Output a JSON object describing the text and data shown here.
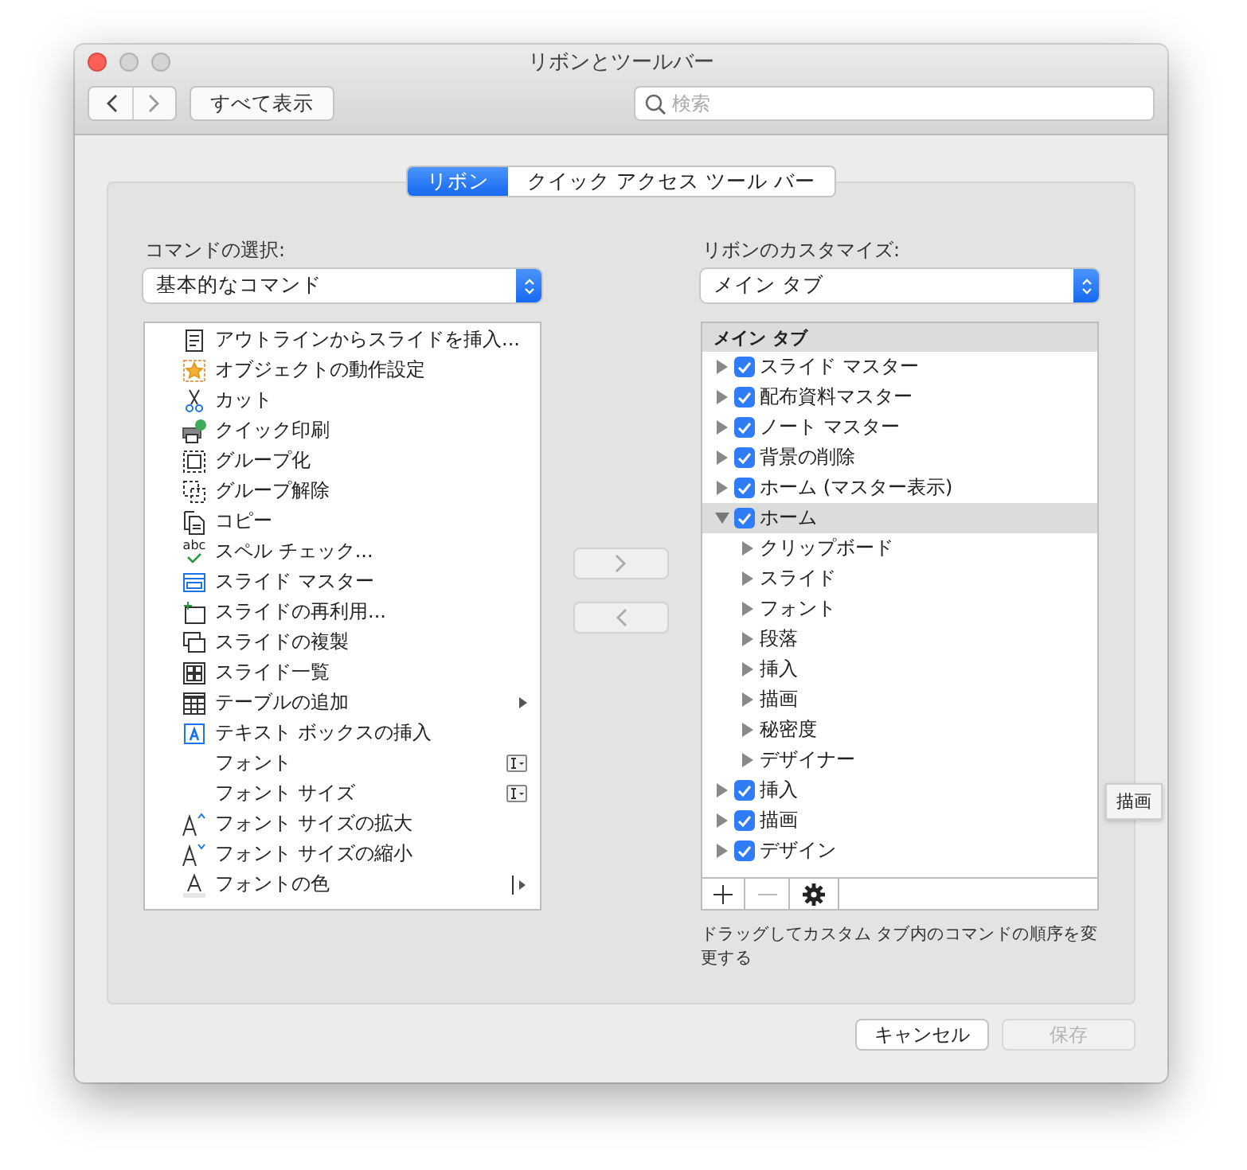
{
  "window": {
    "title": "リボンとツールバー"
  },
  "toolbar": {
    "show_all": "すべて表示",
    "search": {
      "placeholder": "検索"
    }
  },
  "tabs": [
    {
      "label": "リボン",
      "selected": true
    },
    {
      "label": "クイック アクセス ツール バー",
      "selected": false
    }
  ],
  "commands": {
    "label": "コマンドの選択:",
    "select": "基本的なコマンド",
    "items": [
      {
        "label": "アウトラインからスライドを挿入...",
        "kind": "outline"
      },
      {
        "label": "オブジェクトの動作設定",
        "kind": "action"
      },
      {
        "label": "カット",
        "kind": "cut"
      },
      {
        "label": "クイック印刷",
        "kind": "print"
      },
      {
        "label": "グループ化",
        "kind": "group"
      },
      {
        "label": "グループ解除",
        "kind": "ungroup"
      },
      {
        "label": "コピー",
        "kind": "copy"
      },
      {
        "label": "スペル チェック...",
        "kind": "spell",
        "icon_text": "abc"
      },
      {
        "label": "スライド マスター",
        "kind": "master"
      },
      {
        "label": "スライドの再利用...",
        "kind": "reuse"
      },
      {
        "label": "スライドの複製",
        "kind": "duplicate"
      },
      {
        "label": "スライド一覧",
        "kind": "sorter"
      },
      {
        "label": "テーブルの追加",
        "kind": "table",
        "trailing": {
          "kind": "submenu"
        }
      },
      {
        "label": "テキスト ボックスの挿入",
        "kind": "textbox"
      },
      {
        "label": "フォント",
        "kind": "none",
        "trailing": {
          "kind": "combo"
        }
      },
      {
        "label": "フォント サイズ",
        "kind": "none",
        "trailing": {
          "kind": "combo"
        }
      },
      {
        "label": "フォント サイズの拡大",
        "kind": "grow"
      },
      {
        "label": "フォント サイズの縮小",
        "kind": "shrink"
      },
      {
        "label": "フォントの色",
        "kind": "color",
        "trailing": {
          "kind": "split"
        }
      }
    ]
  },
  "ribbon": {
    "label": "リボンのカスタマイズ:",
    "select": "メイン タブ",
    "header": "メイン タブ",
    "items": [
      {
        "label": "スライド マスター",
        "checked": true,
        "expanded": false,
        "selected": false
      },
      {
        "label": "配布資料マスター",
        "checked": true,
        "expanded": false,
        "selected": false
      },
      {
        "label": "ノート マスター",
        "checked": true,
        "expanded": false,
        "selected": false
      },
      {
        "label": "背景の削除",
        "checked": true,
        "expanded": false,
        "selected": false
      },
      {
        "label": "ホーム (マスター表示)",
        "checked": true,
        "expanded": false,
        "selected": false
      },
      {
        "label": "ホーム",
        "checked": true,
        "expanded": true,
        "selected": true,
        "children": [
          {
            "label": "クリップボード",
            "expanded": false
          },
          {
            "label": "スライド",
            "expanded": false
          },
          {
            "label": "フォント",
            "expanded": false
          },
          {
            "label": "段落",
            "expanded": false
          },
          {
            "label": "挿入",
            "expanded": false
          },
          {
            "label": "描画",
            "expanded": false
          },
          {
            "label": "秘密度",
            "expanded": false
          },
          {
            "label": "デザイナー",
            "expanded": false
          }
        ]
      },
      {
        "label": "挿入",
        "checked": true,
        "expanded": false,
        "selected": false
      },
      {
        "label": "描画",
        "checked": true,
        "expanded": false,
        "selected": false
      },
      {
        "label": "デザイン",
        "checked": true,
        "expanded": false,
        "selected": false
      }
    ],
    "hint": "ドラッグしてカスタム タブ内のコマンドの順序を変更する"
  },
  "tooltip": "描画",
  "buttons": [
    {
      "label": "キャンセル",
      "disabled": false
    },
    {
      "label": "保存",
      "disabled": true
    }
  ]
}
